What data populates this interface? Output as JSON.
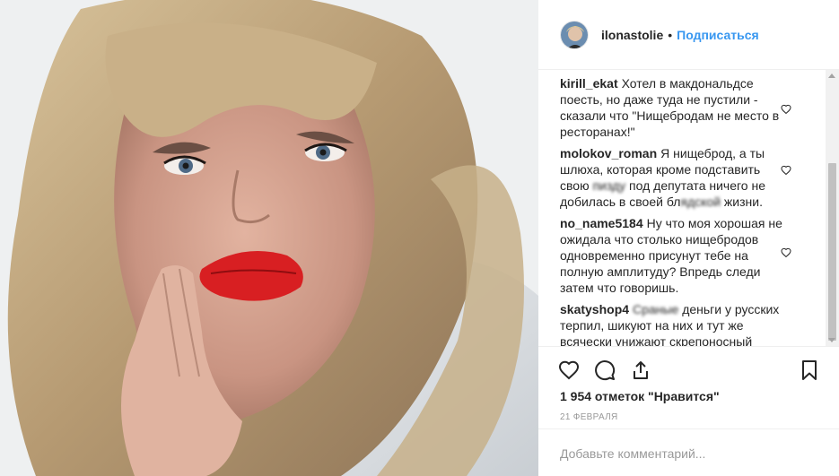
{
  "post": {
    "photo_alt": "Portrait photo",
    "author": {
      "username": "ilonastolie",
      "separator": "•",
      "follow_label": "Подписаться"
    }
  },
  "comments": [
    {
      "author": "kirill_ekat",
      "text": "Хотел в макдональдсе поесть, но даже туда не пустили - сказали что \"Нищебродам не место в ресторанах!\"",
      "liked": false
    },
    {
      "author": "molokov_roman",
      "text_parts": [
        "Я нищеброд, а ты шлюха, которая кроме подставить свою ",
        "пизду",
        " под депутата ничего не добилась в своей ",
        "бл",
        "ядской",
        " жизни."
      ],
      "liked": false
    },
    {
      "author": "no_name5184",
      "text": "Ну что моя хорошая не ожидала что столько нищебродов одновременно присунут тебе на полную амплитуду? Впредь следи затем что говоришь.",
      "liked": false
    },
    {
      "author": "skatyshop4",
      "text_parts": [
        "Сраные",
        " деньги у русских терпил, шикуют на них и тут же всячески унижают скрепоносный"
      ],
      "liked": false
    }
  ],
  "actions": {
    "like_icon": "heart-icon",
    "comment_icon": "comment-icon",
    "share_icon": "share-icon",
    "save_icon": "bookmark-icon"
  },
  "likes_text": "1 954 отметок \"Нравится\"",
  "date_text": "21 февраля",
  "add_comment": {
    "placeholder": "Добавьте комментарий..."
  },
  "colors": {
    "link": "#3897f0",
    "text": "#262626",
    "muted": "#999999",
    "border": "#efefef"
  }
}
